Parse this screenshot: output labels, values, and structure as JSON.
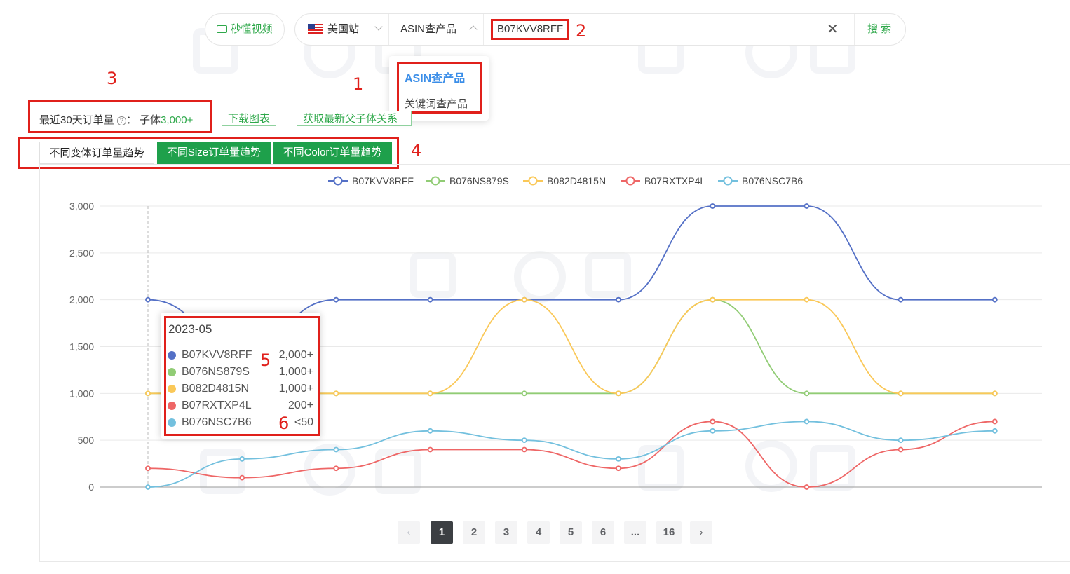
{
  "header": {
    "video_label": "秒懂视频",
    "site_label": "美国站",
    "mode_label": "ASIN查产品",
    "search_value": "B07KVV8RFF",
    "search_button": "搜 索",
    "clear_icon": "close-icon"
  },
  "dropdown": {
    "options": [
      "ASIN查产品",
      "关键词查产品"
    ],
    "selected": "ASIN查产品"
  },
  "annotations": [
    "1",
    "2",
    "3",
    "4",
    "5",
    "6"
  ],
  "summary": {
    "label": "最近30天订单量",
    "help_icon": "question-icon",
    "separator": "：",
    "value_prefix": "子体",
    "value": "3,000+"
  },
  "buttons": {
    "download": "下载图表",
    "fetch": "获取最新父子体关系"
  },
  "tabs": [
    "不同变体订单量趋势",
    "不同Size订单量趋势",
    "不同Color订单量趋势"
  ],
  "colors": {
    "accent_green": "#2ea84a",
    "tab_green": "#1ea04b",
    "annotation_red": "#e0201b"
  },
  "tooltip": {
    "title": "2023-05",
    "rows": [
      {
        "name": "B07KVV8RFF",
        "value": "2,000+",
        "color": "#5470c6"
      },
      {
        "name": "B076NS879S",
        "value": "1,000+",
        "color": "#91cc75"
      },
      {
        "name": "B082D4815N",
        "value": "1,000+",
        "color": "#fac858"
      },
      {
        "name": "B07RXTXP4L",
        "value": "200+",
        "color": "#ee6666"
      },
      {
        "name": "B076NSC7B6",
        "value": "<50",
        "color": "#73c0de"
      }
    ]
  },
  "pagination": {
    "pages": [
      "1",
      "2",
      "3",
      "4",
      "5",
      "6",
      "...",
      "16"
    ],
    "current": "1",
    "prev_icon": "chevron-left-icon",
    "next_icon": "chevron-right-icon"
  },
  "chart_data": {
    "type": "line",
    "x_count": 10,
    "y_ticks": [
      "0",
      "500",
      "1,000",
      "1,500",
      "2,000",
      "2,500",
      "3,000"
    ],
    "ylim": [
      0,
      3000
    ],
    "grid": true,
    "legend_position": "top-center",
    "smooth": true,
    "series": [
      {
        "name": "B07KVV8RFF",
        "color": "#5470c6",
        "values": [
          2000,
          1500,
          2000,
          2000,
          2000,
          2000,
          3000,
          3000,
          2000,
          2000
        ]
      },
      {
        "name": "B076NS879S",
        "color": "#91cc75",
        "values": [
          1000,
          1000,
          1000,
          1000,
          1000,
          1000,
          2000,
          1000,
          1000,
          1000
        ]
      },
      {
        "name": "B082D4815N",
        "color": "#fac858",
        "values": [
          1000,
          1000,
          1000,
          1000,
          2000,
          1000,
          2000,
          2000,
          1000,
          1000
        ]
      },
      {
        "name": "B07RXTXP4L",
        "color": "#ee6666",
        "values": [
          200,
          100,
          200,
          400,
          400,
          200,
          700,
          0,
          400,
          700
        ]
      },
      {
        "name": "B076NSC7B6",
        "color": "#73c0de",
        "values": [
          0,
          300,
          400,
          600,
          500,
          300,
          600,
          700,
          500,
          600
        ]
      }
    ]
  }
}
